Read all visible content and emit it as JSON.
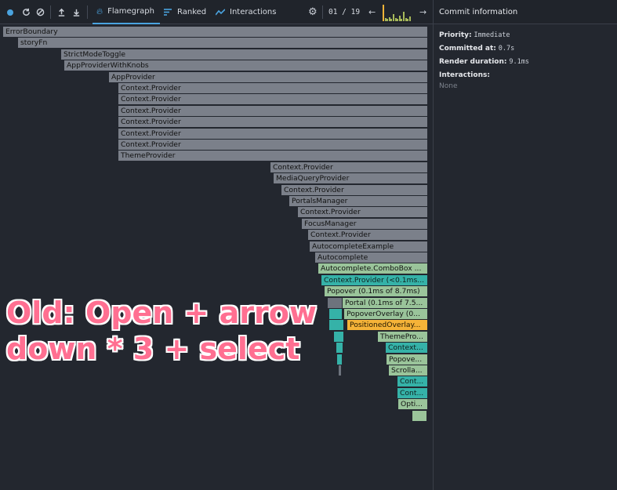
{
  "toolbar": {
    "record_icon": "record-dot-icon",
    "reload_icon": "reload-icon",
    "clear_icon": "clear-icon",
    "upload_icon": "upload-icon",
    "download_icon": "download-icon",
    "tabs": [
      {
        "label": "Flamegraph",
        "icon": "flame-icon",
        "active": true
      },
      {
        "label": "Ranked",
        "icon": "ranked-icon",
        "active": false
      },
      {
        "label": "Interactions",
        "icon": "interactions-icon",
        "active": false
      }
    ],
    "settings_icon": "gear-icon",
    "commit_position": "01 / 19",
    "prev_icon": "arrow-left-icon",
    "next_icon": "arrow-right-icon"
  },
  "commit_info": {
    "title": "Commit information",
    "priority_label": "Priority:",
    "priority_value": "Immediate",
    "committed_label": "Committed at:",
    "committed_value": "0.7s",
    "render_label": "Render duration:",
    "render_value": "9.1ms",
    "interactions_label": "Interactions:",
    "interactions_value": "None"
  },
  "flamegraph": {
    "nodes": [
      {
        "label": "ErrorBoundary"
      },
      {
        "label": "storyFn"
      },
      {
        "label": "StrictModeToggle"
      },
      {
        "label": "AppProviderWithKnobs"
      },
      {
        "label": "AppProvider"
      },
      {
        "label": "Context.Provider"
      },
      {
        "label": "Context.Provider"
      },
      {
        "label": "Context.Provider"
      },
      {
        "label": "Context.Provider"
      },
      {
        "label": "Context.Provider"
      },
      {
        "label": "Context.Provider"
      },
      {
        "label": "ThemeProvider"
      },
      {
        "label": "Context.Provider"
      },
      {
        "label": "MediaQueryProvider"
      },
      {
        "label": "Context.Provider"
      },
      {
        "label": "PortalsManager"
      },
      {
        "label": "Context.Provider"
      },
      {
        "label": "FocusManager"
      },
      {
        "label": "Context.Provider"
      },
      {
        "label": "AutocompleteExample"
      },
      {
        "label": "Autocomplete"
      },
      {
        "label": "Autocomplete.ComboBox ..."
      },
      {
        "label": "Context.Provider (<0.1ms..."
      },
      {
        "label": "Popover (0.1ms of 8.7ms)"
      },
      {
        "label": "Portal (0.1ms of 7.5..."
      },
      {
        "label": "PopoverOverlay (0..."
      },
      {
        "label": "PositionedOverlay..."
      },
      {
        "label": "ThemePro..."
      },
      {
        "label": "Context..."
      },
      {
        "label": "Popove..."
      },
      {
        "label": "Scrolla..."
      },
      {
        "label": "Cont..."
      },
      {
        "label": "Cont..."
      },
      {
        "label": "Opti..."
      }
    ]
  },
  "annotation": {
    "line1": "Old: Open + arrow",
    "line2": "down * 3 + select"
  },
  "colors": {
    "background": "#23272f",
    "accent": "#4aa3df",
    "bar_grey": "#7b808a",
    "bar_green": "#9ac49a",
    "bar_teal": "#35b2a8",
    "bar_orange": "#f5b338",
    "annotation": "#ff6f91"
  }
}
